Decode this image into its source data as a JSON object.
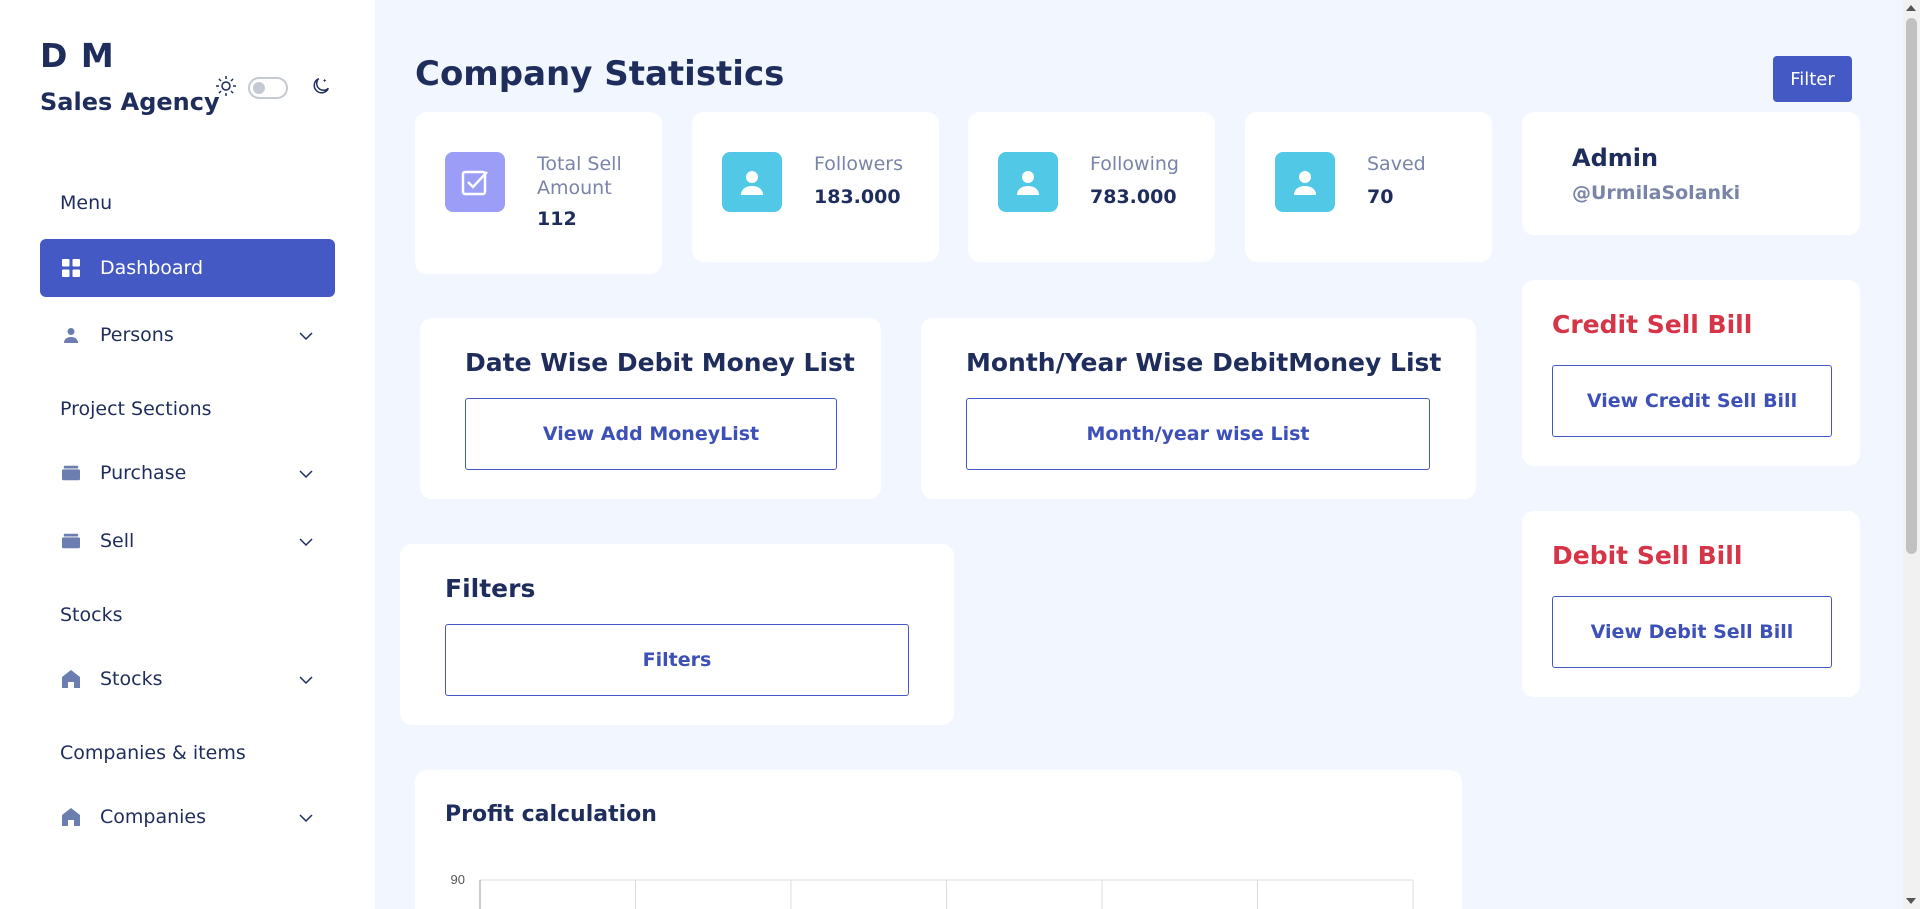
{
  "brand": {
    "line1": "D M",
    "line2": "Sales Agency"
  },
  "sidebar": {
    "sections": [
      {
        "label": "Menu"
      },
      {
        "label": "Project Sections"
      },
      {
        "label": "Stocks"
      },
      {
        "label": "Companies & items"
      }
    ],
    "items": [
      {
        "label": "Dashboard",
        "icon": "grid-icon"
      },
      {
        "label": "Persons",
        "icon": "person-icon"
      },
      {
        "label": "Purchase",
        "icon": "box-icon"
      },
      {
        "label": "Sell",
        "icon": "box-icon"
      },
      {
        "label": "Stocks",
        "icon": "home-icon"
      },
      {
        "label": "Companies",
        "icon": "home-icon"
      }
    ]
  },
  "header": {
    "title": "Company Statistics",
    "filter_label": "Filter"
  },
  "stats": [
    {
      "label": "Total Sell Amount",
      "value": "112",
      "icon": "checkbox-icon",
      "color": "#9b9df7"
    },
    {
      "label": "Followers",
      "value": "183.000",
      "icon": "user-icon",
      "color": "#50c8e6"
    },
    {
      "label": "Following",
      "value": "783.000",
      "icon": "user-icon",
      "color": "#50c8e6"
    },
    {
      "label": "Saved",
      "value": "70",
      "icon": "user-icon",
      "color": "#50c8e6"
    }
  ],
  "admin": {
    "name": "Admin",
    "handle": "@UrmilaSolanki"
  },
  "date_wise": {
    "title": "Date Wise Debit Money List",
    "button": "View Add MoneyList"
  },
  "month_wise": {
    "title": "Month/Year Wise DebitMoney List",
    "button": "Month/year wise List"
  },
  "credit": {
    "title": "Credit Sell Bill",
    "button": "View Credit Sell Bill"
  },
  "debit": {
    "title": "Debit Sell Bill",
    "button": "View Debit Sell Bill"
  },
  "filters": {
    "title": "Filters",
    "button": "Filters"
  },
  "profit": {
    "title": "Profit calculation"
  },
  "chart_data": {
    "type": "bar",
    "title": "",
    "categories": [],
    "values": [],
    "y_ticks": [
      "90"
    ],
    "grid": true
  },
  "colors": {
    "accent": "#4559c4",
    "danger": "#d63447",
    "text": "#1f2d5c"
  }
}
